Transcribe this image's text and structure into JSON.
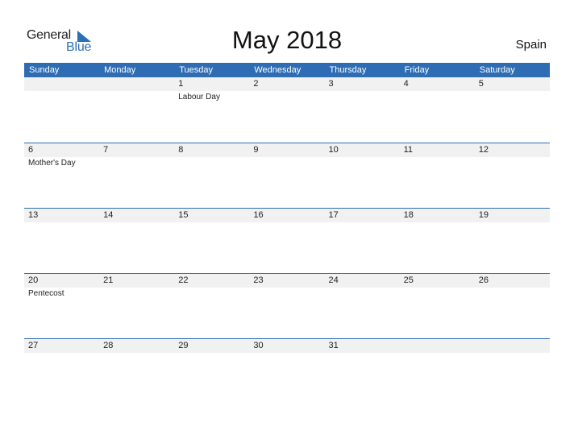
{
  "logo": {
    "text_general": "General",
    "text_blue": "Blue"
  },
  "title": "May 2018",
  "country": "Spain",
  "colors": {
    "accent": "#2e6db4",
    "strip": "#f1f1f1"
  },
  "weekdays": [
    "Sunday",
    "Monday",
    "Tuesday",
    "Wednesday",
    "Thursday",
    "Friday",
    "Saturday"
  ],
  "weeks": [
    {
      "days": [
        "",
        "",
        "1",
        "2",
        "3",
        "4",
        "5"
      ],
      "events": [
        "",
        "",
        "Labour Day",
        "",
        "",
        "",
        ""
      ]
    },
    {
      "days": [
        "6",
        "7",
        "8",
        "9",
        "10",
        "11",
        "12"
      ],
      "events": [
        "Mother's Day",
        "",
        "",
        "",
        "",
        "",
        ""
      ]
    },
    {
      "days": [
        "13",
        "14",
        "15",
        "16",
        "17",
        "18",
        "19"
      ],
      "events": [
        "",
        "",
        "",
        "",
        "",
        "",
        ""
      ]
    },
    {
      "days": [
        "20",
        "21",
        "22",
        "23",
        "24",
        "25",
        "26"
      ],
      "events": [
        "Pentecost",
        "",
        "",
        "",
        "",
        "",
        ""
      ]
    },
    {
      "days": [
        "27",
        "28",
        "29",
        "30",
        "31",
        "",
        ""
      ],
      "events": [
        "",
        "",
        "",
        "",
        "",
        "",
        ""
      ]
    }
  ]
}
